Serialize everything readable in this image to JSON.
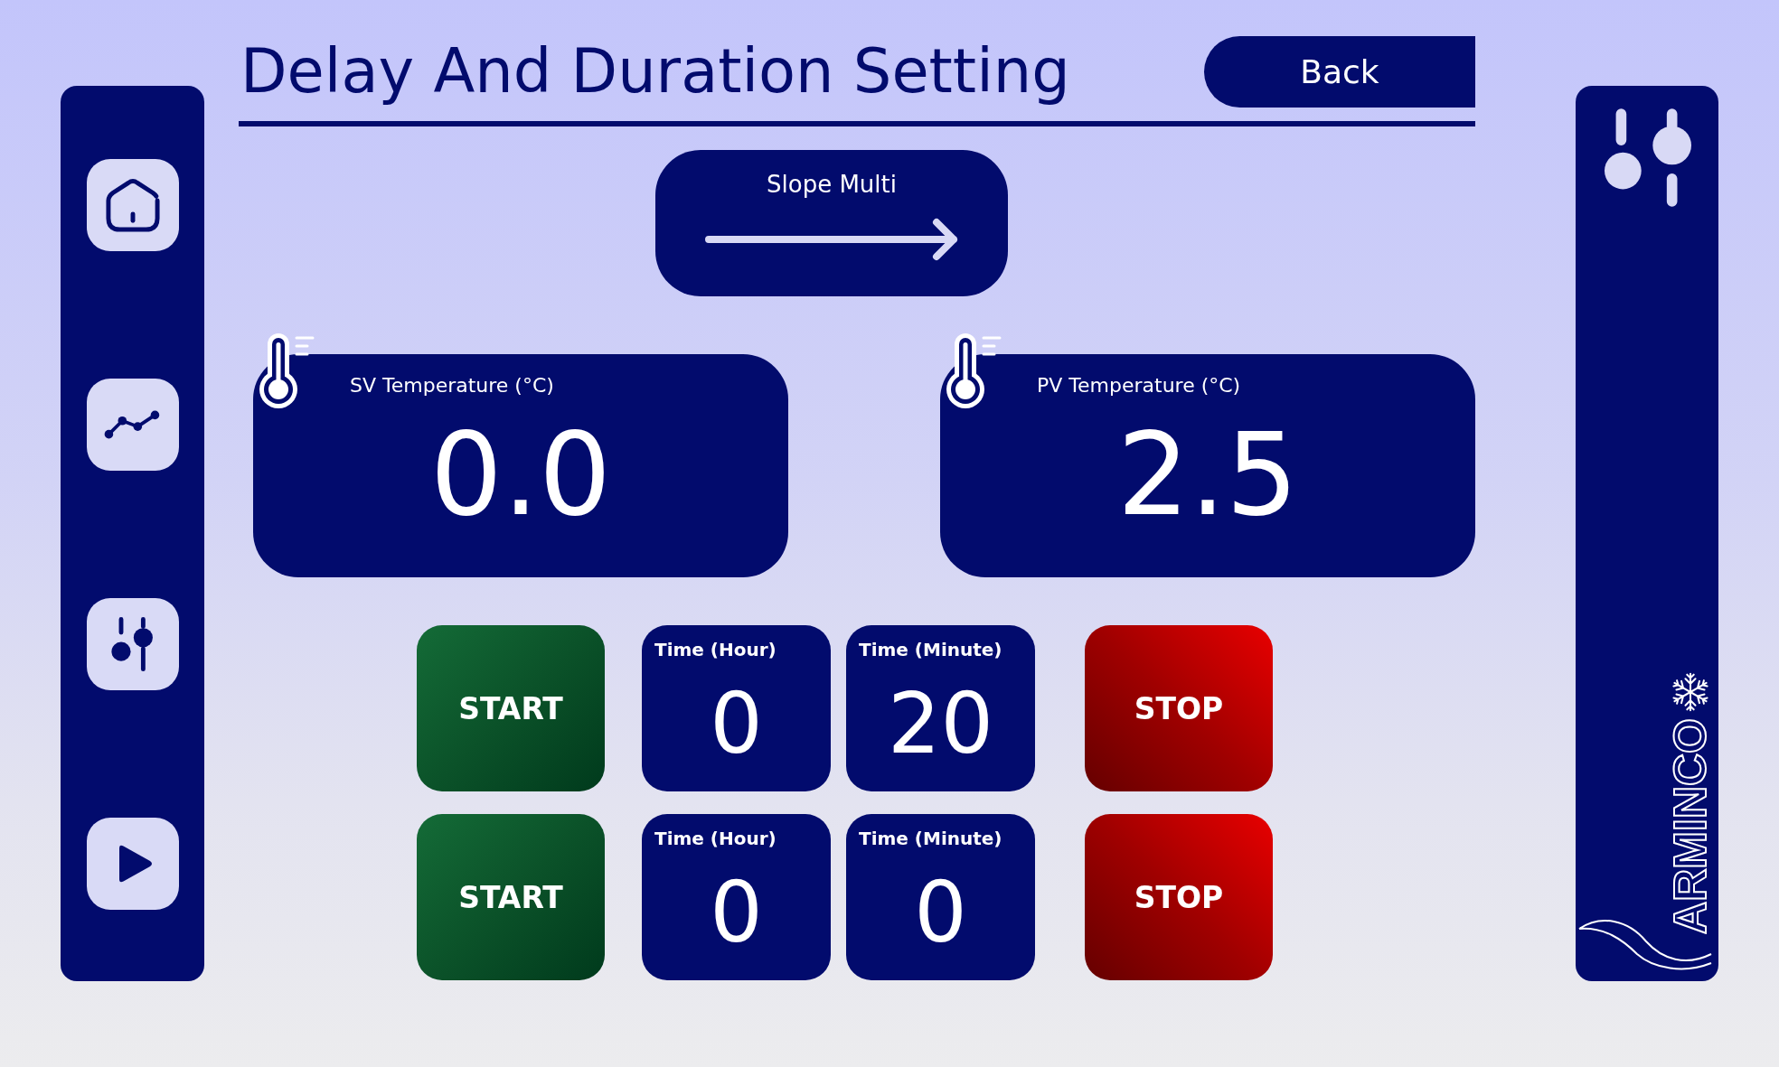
{
  "header": {
    "title": "Delay And Duration Setting",
    "back_button": "Back"
  },
  "slope_button": {
    "label": "Slope Multi"
  },
  "temperatures": [
    {
      "label": "SV Temperature (°C)",
      "value": "0.0"
    },
    {
      "label": "PV Temperature (°C)",
      "value": "2.5"
    }
  ],
  "timers": [
    {
      "start_button": "START",
      "hours": {
        "label": "Time (Hour)",
        "value": "0"
      },
      "minutes": {
        "label": "Time (Minute)",
        "value": "20"
      },
      "stop_button": "STOP"
    },
    {
      "start_button": "START",
      "hours": {
        "label": "Time (Hour)",
        "value": "0"
      },
      "minutes": {
        "label": "Time (Minute)",
        "value": "0"
      },
      "stop_button": "STOP"
    }
  ],
  "logo": {
    "text": "ARMINCO"
  }
}
